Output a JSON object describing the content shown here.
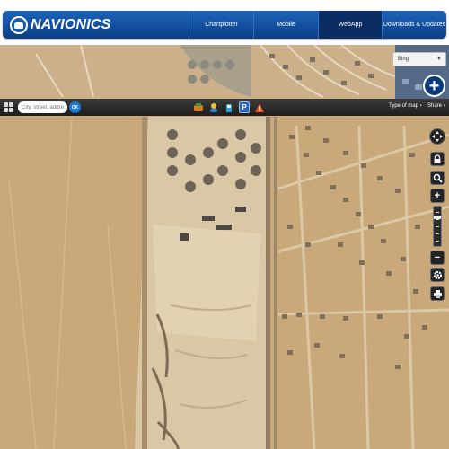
{
  "header": {
    "logo_text": "NAVIONICS",
    "nav": [
      {
        "label": "Chartplotter",
        "active": false
      },
      {
        "label": "Mobile",
        "active": false
      },
      {
        "label": "WebApp",
        "active": true
      },
      {
        "label": "Downloads & Updates",
        "active": false
      }
    ]
  },
  "map": {
    "layer_select": {
      "value": "Bing"
    },
    "zoom_level_fraction": 0.72
  },
  "toolbar": {
    "search_placeholder": "City, street, addre...",
    "ok_label": "OK",
    "parking_label": "P",
    "type_of_map_label": "Type of map",
    "share_label": "Share"
  },
  "colors": {
    "brand_blue": "#0b3f86",
    "toolbar_dark": "#1e1e1e",
    "terrain_sand": "#c7a67a"
  },
  "icons": {
    "grid": "grid-icon",
    "chevron": "chevron-down-icon",
    "add": "plus-icon",
    "navigate": "pan-arrows-icon",
    "lock": "lock-icon",
    "search": "magnifier-icon",
    "zoom_in": "plus-icon",
    "zoom_out": "minus-icon",
    "settings": "gear-icon",
    "printer": "printer-icon"
  }
}
